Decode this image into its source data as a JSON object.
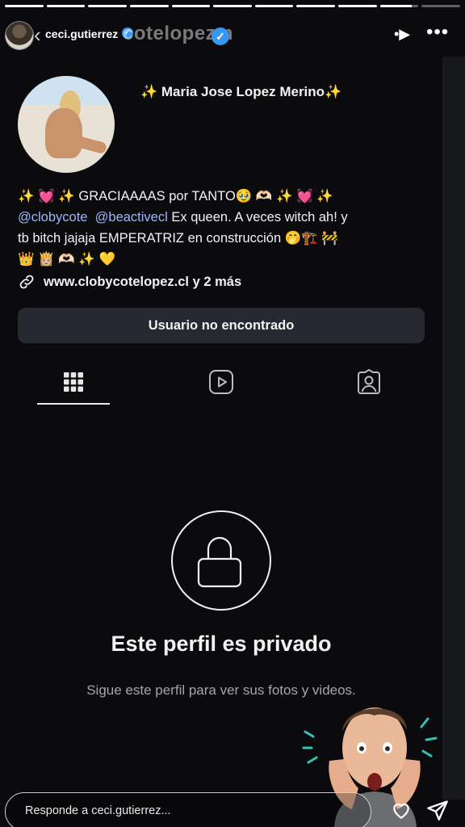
{
  "story": {
    "progress_segments": [
      1,
      1,
      1,
      1,
      1,
      1,
      1,
      1,
      1,
      0.82,
      0
    ],
    "username": "ceci.gutierrez",
    "overlay_handle": "cotelopezm"
  },
  "profile": {
    "display_name": "✨ Maria Jose Lopez Merino✨",
    "bio_line1": "✨ 💓 ✨ GRACIAAAAS por TANTO🥹 🫶🏻 ✨ 💓 ✨",
    "bio_mention1": "@clobycote",
    "bio_mention2": "@beactivecl",
    "bio_line2_rest": " Ex queen. A veces witch ah! y",
    "bio_line3": "tb bitch jajaja EMPERATRIZ en construcción 🤭🏗️ 🚧",
    "bio_line4": "👑 👸🏼 🫶🏻 ✨ 💛",
    "link_text": "www.clobycotelopez.cl y 2 más",
    "user_button": "Usuario no encontrado"
  },
  "private": {
    "title": "Este perfil es privado",
    "subtitle": "Sigue este perfil para ver sus fotos y videos."
  },
  "reply": {
    "placeholder": "Responde a ceci.gutierrez..."
  },
  "colors": {
    "background": "#0b0b0e",
    "mention": "#9db8ff",
    "button_bg": "#262a30",
    "verified": "#3897f0"
  }
}
